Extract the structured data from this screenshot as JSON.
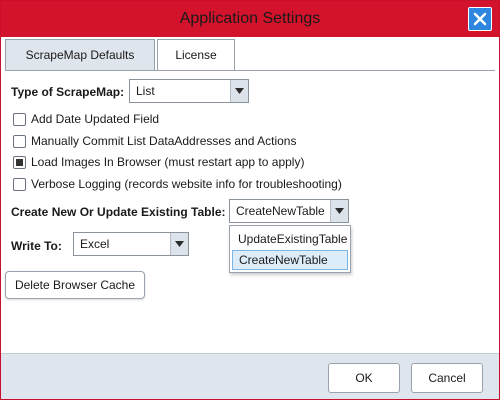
{
  "window": {
    "title": "Application Settings"
  },
  "tabs": [
    {
      "label": "ScrapeMap Defaults",
      "active": true
    },
    {
      "label": "License",
      "active": false
    }
  ],
  "scrapemap_type": {
    "label": "Type of ScrapeMap:",
    "value": "List"
  },
  "options": [
    {
      "label": "Add Date Updated Field",
      "checked": false
    },
    {
      "label": "Manually Commit List DataAddresses and Actions",
      "checked": false
    },
    {
      "label": "Load Images In Browser (must restart app to apply)",
      "checked": true
    },
    {
      "label": "Verbose Logging (records website info for troubleshooting)",
      "checked": false
    }
  ],
  "table_mode": {
    "label": "Create New Or Update Existing Table:",
    "value": "CreateNewTable",
    "options": [
      "UpdateExistingTable",
      "CreateNewTable"
    ]
  },
  "write_to": {
    "label": "Write To:",
    "value": "Excel"
  },
  "buttons": {
    "delete_cache": "Delete Browser Cache",
    "ok": "OK",
    "cancel": "Cancel"
  },
  "colors": {
    "title_bar": "#d3132b",
    "close_button": "#2e86de",
    "footer": "#dfe5ed",
    "selected_item": "#dcecf9"
  }
}
